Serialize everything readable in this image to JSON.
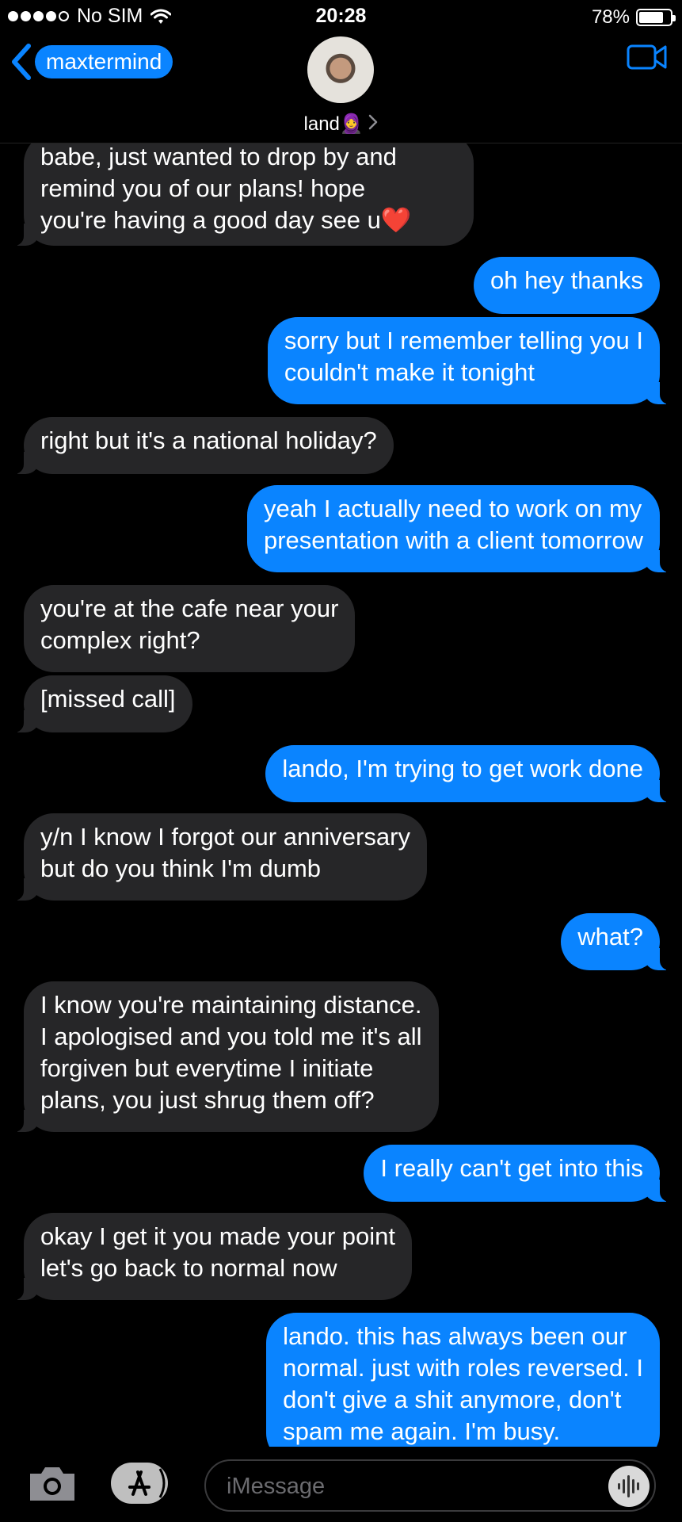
{
  "status_bar": {
    "carrier": "No SIM",
    "time": "20:28",
    "battery": "78%",
    "battery_level": 0.78
  },
  "header": {
    "back_label": "maxtermind",
    "contact_name": "land",
    "contact_emoji": "🧕"
  },
  "messages": [
    {
      "from": "them",
      "lines": [
        "babe, just wanted to drop by and",
        "remind you of our plans! hope",
        "you're having a good day see u"
      ],
      "emoji": "❤️"
    },
    {
      "from": "me",
      "lines": [
        "oh hey thanks"
      ]
    },
    {
      "from": "me",
      "lines": [
        "sorry but I remember telling you I",
        "couldn't make it tonight"
      ]
    },
    {
      "from": "them",
      "lines": [
        "right but it's a national holiday?"
      ]
    },
    {
      "from": "me",
      "lines": [
        "yeah I actually need to work on my",
        "presentation with a client tomorrow"
      ]
    },
    {
      "from": "them",
      "lines": [
        "you're at the cafe near your",
        "complex right?"
      ]
    },
    {
      "from": "them",
      "lines": [
        "[missed call]"
      ]
    },
    {
      "from": "me",
      "lines": [
        "lando, I'm trying to get work done"
      ]
    },
    {
      "from": "them",
      "lines": [
        "y/n I know I forgot our anniversary",
        "but do you think I'm dumb"
      ]
    },
    {
      "from": "me",
      "lines": [
        "what?"
      ]
    },
    {
      "from": "them",
      "lines": [
        "I know you're maintaining distance.",
        "I apologised and you told me it's all",
        "forgiven but everytime I initiate",
        "plans, you just shrug them off?"
      ]
    },
    {
      "from": "me",
      "lines": [
        "I really can't get into this"
      ]
    },
    {
      "from": "them",
      "lines": [
        "okay I get it you made your point",
        "let's go back to normal now"
      ]
    },
    {
      "from": "me",
      "lines": [
        "lando. this has always been our",
        "normal. just with roles reversed. I",
        "don't give a shit anymore, don't",
        "spam me again. I'm busy."
      ]
    }
  ],
  "input": {
    "placeholder": "iMessage"
  },
  "icons": {
    "back": "chevron-left-icon",
    "video": "video-camera-icon",
    "camera": "camera-icon",
    "apps": "app-store-icon",
    "audio": "audio-waveform-icon"
  },
  "colors": {
    "outgoing": "#0a84ff",
    "incoming": "#262628",
    "background": "#000000"
  }
}
